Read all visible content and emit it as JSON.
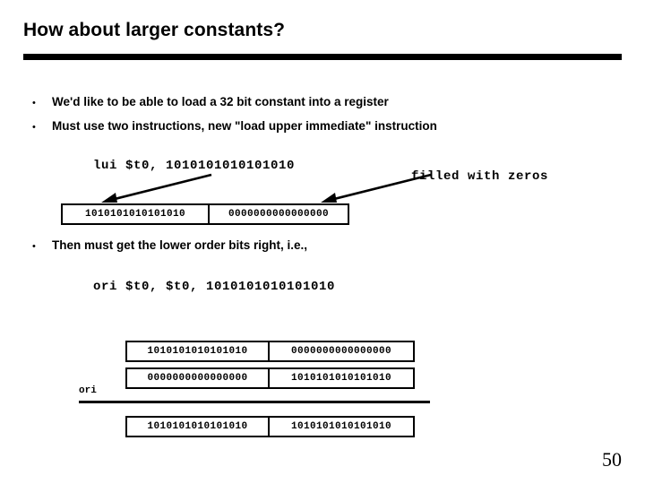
{
  "slide": {
    "title": "How about larger constants?",
    "page_number": "50"
  },
  "bullets": [
    {
      "marker": "•",
      "text": "We'd like to be able to load a 32 bit constant into a register"
    },
    {
      "marker": "•",
      "text": "Must use two instructions, new \"load upper immediate\" instruction"
    },
    {
      "marker": "•",
      "text": "Then must get the lower order bits right, i.e.,"
    }
  ],
  "lui_example": {
    "instruction": "lui $t0, 1010101010101010",
    "annotation": "filled with zeros",
    "register_cells": [
      "1010101010101010",
      "0000000000000000"
    ]
  },
  "ori_example": {
    "instruction": "ori $t0, $t0, 1010101010101010",
    "operator_label": "ori",
    "rows": [
      {
        "name": "operand-upper",
        "cells": [
          "1010101010101010",
          "0000000000000000"
        ]
      },
      {
        "name": "operand-lower",
        "cells": [
          "0000000000000000",
          "1010101010101010"
        ]
      },
      {
        "name": "result",
        "cells": [
          "1010101010101010",
          "1010101010101010"
        ]
      }
    ]
  },
  "colors": {
    "text": "#000000",
    "background": "#ffffff",
    "rule": "#000000"
  }
}
